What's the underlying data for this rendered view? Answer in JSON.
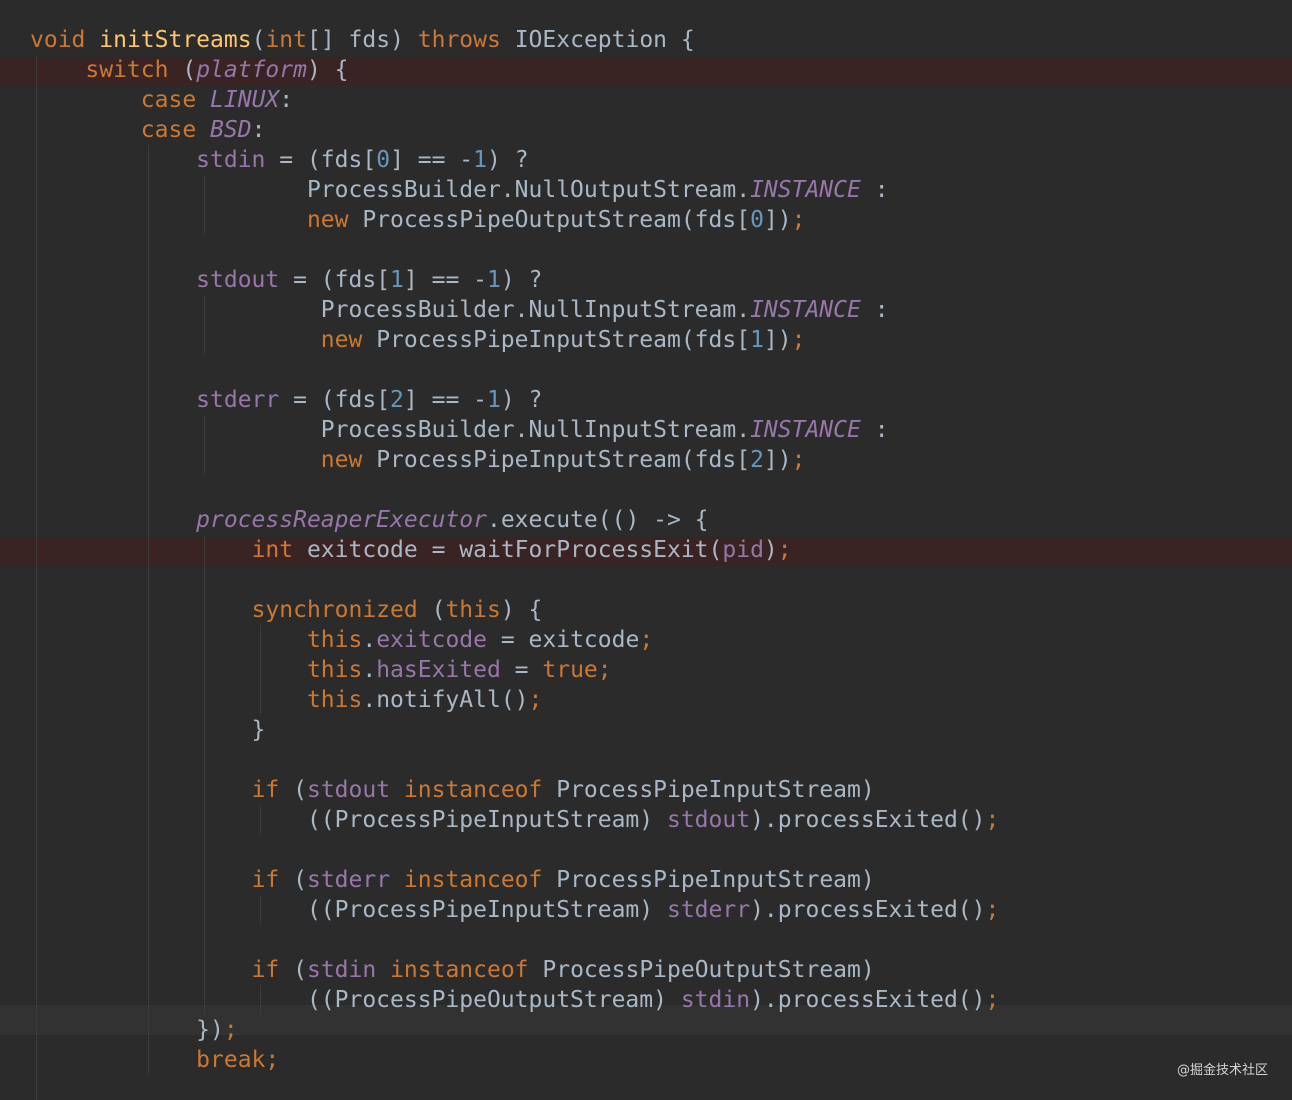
{
  "colors": {
    "background": "#2b2b2b",
    "keyword": "#cc7832",
    "method": "#ffc66d",
    "number": "#6897bb",
    "field": "#9876aa",
    "text": "#a9b7c6",
    "breakpoint_line": "#3a2323",
    "caret_line": "#323232"
  },
  "editor": {
    "breakpoint_lines": [
      2,
      18
    ],
    "caret_line": 34,
    "lines": [
      [
        {
          "t": "void ",
          "c": "keyword"
        },
        {
          "t": "initStreams",
          "c": "method"
        },
        {
          "t": "(",
          "c": "plain"
        },
        {
          "t": "int",
          "c": "keyword"
        },
        {
          "t": "[] fds) ",
          "c": "plain"
        },
        {
          "t": "throws ",
          "c": "keyword"
        },
        {
          "t": "IOException {",
          "c": "plain"
        }
      ],
      [
        {
          "t": "    ",
          "c": "plain"
        },
        {
          "t": "switch ",
          "c": "keyword"
        },
        {
          "t": "(",
          "c": "plain"
        },
        {
          "t": "platform",
          "c": "italic"
        },
        {
          "t": ") {",
          "c": "plain"
        }
      ],
      [
        {
          "t": "        ",
          "c": "plain"
        },
        {
          "t": "case ",
          "c": "keyword"
        },
        {
          "t": "LINUX",
          "c": "italic"
        },
        {
          "t": ":",
          "c": "plain"
        }
      ],
      [
        {
          "t": "        ",
          "c": "plain"
        },
        {
          "t": "case ",
          "c": "keyword"
        },
        {
          "t": "BSD",
          "c": "italic"
        },
        {
          "t": ":",
          "c": "plain"
        }
      ],
      [
        {
          "t": "            ",
          "c": "plain"
        },
        {
          "t": "stdin",
          "c": "field"
        },
        {
          "t": " = (fds[",
          "c": "plain"
        },
        {
          "t": "0",
          "c": "number"
        },
        {
          "t": "] == -",
          "c": "plain"
        },
        {
          "t": "1",
          "c": "number"
        },
        {
          "t": ") ?",
          "c": "plain"
        }
      ],
      [
        {
          "t": "                    ProcessBuilder.NullOutputStream.",
          "c": "plain"
        },
        {
          "t": "INSTANCE",
          "c": "italic"
        },
        {
          "t": " :",
          "c": "plain"
        }
      ],
      [
        {
          "t": "                    ",
          "c": "plain"
        },
        {
          "t": "new ",
          "c": "keyword"
        },
        {
          "t": "ProcessPipeOutputStream(fds[",
          "c": "plain"
        },
        {
          "t": "0",
          "c": "number"
        },
        {
          "t": "])",
          "c": "plain"
        },
        {
          "t": ";",
          "c": "keyword"
        }
      ],
      [],
      [
        {
          "t": "            ",
          "c": "plain"
        },
        {
          "t": "stdout",
          "c": "field"
        },
        {
          "t": " = (fds[",
          "c": "plain"
        },
        {
          "t": "1",
          "c": "number"
        },
        {
          "t": "] == -",
          "c": "plain"
        },
        {
          "t": "1",
          "c": "number"
        },
        {
          "t": ") ?",
          "c": "plain"
        }
      ],
      [
        {
          "t": "                     ProcessBuilder.NullInputStream.",
          "c": "plain"
        },
        {
          "t": "INSTANCE",
          "c": "italic"
        },
        {
          "t": " :",
          "c": "plain"
        }
      ],
      [
        {
          "t": "                     ",
          "c": "plain"
        },
        {
          "t": "new ",
          "c": "keyword"
        },
        {
          "t": "ProcessPipeInputStream(fds[",
          "c": "plain"
        },
        {
          "t": "1",
          "c": "number"
        },
        {
          "t": "])",
          "c": "plain"
        },
        {
          "t": ";",
          "c": "keyword"
        }
      ],
      [],
      [
        {
          "t": "            ",
          "c": "plain"
        },
        {
          "t": "stderr",
          "c": "field"
        },
        {
          "t": " = (fds[",
          "c": "plain"
        },
        {
          "t": "2",
          "c": "number"
        },
        {
          "t": "] == -",
          "c": "plain"
        },
        {
          "t": "1",
          "c": "number"
        },
        {
          "t": ") ?",
          "c": "plain"
        }
      ],
      [
        {
          "t": "                     ProcessBuilder.NullInputStream.",
          "c": "plain"
        },
        {
          "t": "INSTANCE",
          "c": "italic"
        },
        {
          "t": " :",
          "c": "plain"
        }
      ],
      [
        {
          "t": "                     ",
          "c": "plain"
        },
        {
          "t": "new ",
          "c": "keyword"
        },
        {
          "t": "ProcessPipeInputStream(fds[",
          "c": "plain"
        },
        {
          "t": "2",
          "c": "number"
        },
        {
          "t": "])",
          "c": "plain"
        },
        {
          "t": ";",
          "c": "keyword"
        }
      ],
      [],
      [
        {
          "t": "            ",
          "c": "plain"
        },
        {
          "t": "processReaperExecutor",
          "c": "italic"
        },
        {
          "t": ".execute(() -> {",
          "c": "plain"
        }
      ],
      [
        {
          "t": "                ",
          "c": "plain"
        },
        {
          "t": "int ",
          "c": "keyword"
        },
        {
          "t": "exitcode = waitForProcessExit(",
          "c": "plain"
        },
        {
          "t": "pid",
          "c": "field"
        },
        {
          "t": ")",
          "c": "plain"
        },
        {
          "t": ";",
          "c": "keyword"
        }
      ],
      [],
      [
        {
          "t": "                ",
          "c": "plain"
        },
        {
          "t": "synchronized ",
          "c": "keyword"
        },
        {
          "t": "(",
          "c": "plain"
        },
        {
          "t": "this",
          "c": "keyword"
        },
        {
          "t": ") {",
          "c": "plain"
        }
      ],
      [
        {
          "t": "                    ",
          "c": "plain"
        },
        {
          "t": "this",
          "c": "keyword"
        },
        {
          "t": ".",
          "c": "plain"
        },
        {
          "t": "exitcode",
          "c": "field"
        },
        {
          "t": " = exitcode",
          "c": "plain"
        },
        {
          "t": ";",
          "c": "keyword"
        }
      ],
      [
        {
          "t": "                    ",
          "c": "plain"
        },
        {
          "t": "this",
          "c": "keyword"
        },
        {
          "t": ".",
          "c": "plain"
        },
        {
          "t": "hasExited",
          "c": "field"
        },
        {
          "t": " = ",
          "c": "plain"
        },
        {
          "t": "true;",
          "c": "keyword"
        }
      ],
      [
        {
          "t": "                    ",
          "c": "plain"
        },
        {
          "t": "this",
          "c": "keyword"
        },
        {
          "t": ".notifyAll()",
          "c": "plain"
        },
        {
          "t": ";",
          "c": "keyword"
        }
      ],
      [
        {
          "t": "                }",
          "c": "plain"
        }
      ],
      [],
      [
        {
          "t": "                ",
          "c": "plain"
        },
        {
          "t": "if ",
          "c": "keyword"
        },
        {
          "t": "(",
          "c": "plain"
        },
        {
          "t": "stdout ",
          "c": "field"
        },
        {
          "t": "instanceof ",
          "c": "keyword"
        },
        {
          "t": "ProcessPipeInputStream)",
          "c": "plain"
        }
      ],
      [
        {
          "t": "                    ((ProcessPipeInputStream) ",
          "c": "plain"
        },
        {
          "t": "stdout",
          "c": "field"
        },
        {
          "t": ").processExited()",
          "c": "plain"
        },
        {
          "t": ";",
          "c": "keyword"
        }
      ],
      [],
      [
        {
          "t": "                ",
          "c": "plain"
        },
        {
          "t": "if ",
          "c": "keyword"
        },
        {
          "t": "(",
          "c": "plain"
        },
        {
          "t": "stderr ",
          "c": "field"
        },
        {
          "t": "instanceof ",
          "c": "keyword"
        },
        {
          "t": "ProcessPipeInputStream)",
          "c": "plain"
        }
      ],
      [
        {
          "t": "                    ((ProcessPipeInputStream) ",
          "c": "plain"
        },
        {
          "t": "stderr",
          "c": "field"
        },
        {
          "t": ").processExited()",
          "c": "plain"
        },
        {
          "t": ";",
          "c": "keyword"
        }
      ],
      [],
      [
        {
          "t": "                ",
          "c": "plain"
        },
        {
          "t": "if ",
          "c": "keyword"
        },
        {
          "t": "(",
          "c": "plain"
        },
        {
          "t": "stdin ",
          "c": "field"
        },
        {
          "t": "instanceof ",
          "c": "keyword"
        },
        {
          "t": "ProcessPipeOutputStream)",
          "c": "plain"
        }
      ],
      [
        {
          "t": "                    ((ProcessPipeOutputStream) ",
          "c": "plain"
        },
        {
          "t": "stdin",
          "c": "field"
        },
        {
          "t": ").processExited()",
          "c": "plain"
        },
        {
          "t": ";",
          "c": "keyword"
        }
      ],
      [
        {
          "t": "            })",
          "c": "plain"
        },
        {
          "t": ";",
          "c": "keyword"
        }
      ],
      [
        {
          "t": "            ",
          "c": "plain"
        },
        {
          "t": "break;",
          "c": "keyword"
        }
      ]
    ]
  },
  "watermark": {
    "text": "@掘金技术社区"
  }
}
